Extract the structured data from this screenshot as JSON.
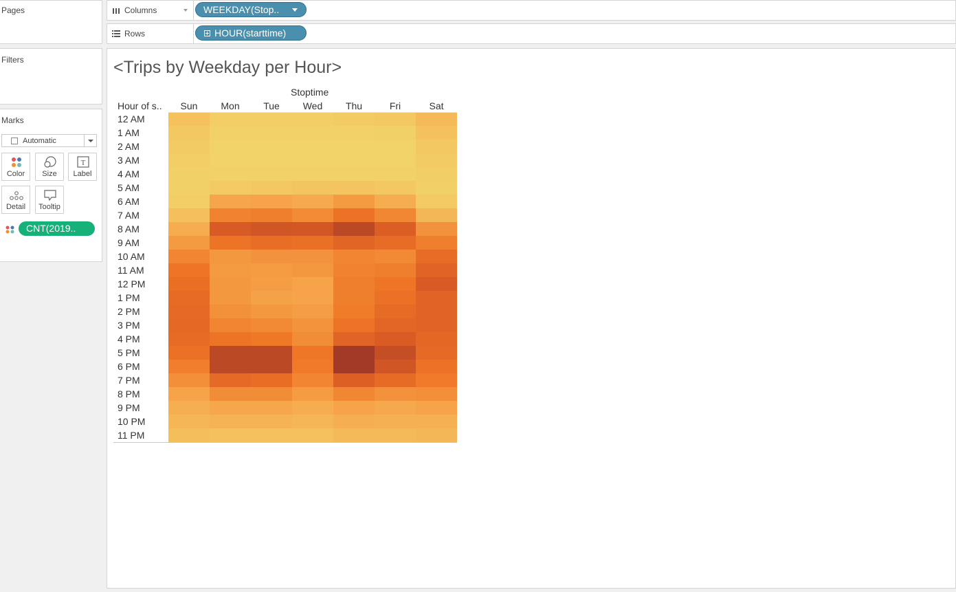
{
  "side": {
    "pages_title": "Pages",
    "filters_title": "Filters",
    "marks_title": "Marks",
    "mark_type": "Automatic",
    "buttons": [
      "Color",
      "Size",
      "Label",
      "Detail",
      "Tooltip"
    ],
    "measure_pill": "CNT(2019.."
  },
  "shelves": {
    "columns_label": "Columns",
    "rows_label": "Rows",
    "columns_pill": "WEEKDAY(Stop..",
    "rows_pill": "HOUR(starttime)"
  },
  "view": {
    "title": "<Trips by Weekday per Hour>",
    "column_dimension": "Stoptime",
    "row_header": "Hour of s.."
  },
  "colors": {
    "pill_blue": "#4a8fad",
    "pill_green": "#16b079",
    "heat_low": "#f2d36a",
    "heat_high": "#a33a28"
  },
  "chart_data": {
    "type": "heatmap",
    "title": "<Trips by Weekday per Hour>",
    "columns": [
      "Sun",
      "Mon",
      "Tue",
      "Wed",
      "Thu",
      "Fri",
      "Sat"
    ],
    "rows": [
      "12 AM",
      "1 AM",
      "2 AM",
      "3 AM",
      "4 AM",
      "5 AM",
      "6 AM",
      "7 AM",
      "8 AM",
      "9 AM",
      "10 AM",
      "11 AM",
      "12 PM",
      "1 PM",
      "2 PM",
      "3 PM",
      "4 PM",
      "5 PM",
      "6 PM",
      "7 PM",
      "8 PM",
      "9 PM",
      "10 PM",
      "11 PM"
    ],
    "values": [
      [
        0.12,
        0.04,
        0.04,
        0.04,
        0.05,
        0.07,
        0.16
      ],
      [
        0.08,
        0.01,
        0.01,
        0.01,
        0.01,
        0.02,
        0.12
      ],
      [
        0.05,
        0.0,
        0.0,
        0.0,
        0.0,
        0.0,
        0.07
      ],
      [
        0.04,
        0.0,
        0.0,
        0.0,
        0.0,
        0.0,
        0.05
      ],
      [
        0.02,
        0.01,
        0.01,
        0.01,
        0.01,
        0.01,
        0.03
      ],
      [
        0.02,
        0.06,
        0.07,
        0.09,
        0.1,
        0.07,
        0.02
      ],
      [
        0.04,
        0.3,
        0.31,
        0.27,
        0.36,
        0.25,
        0.06
      ],
      [
        0.13,
        0.48,
        0.5,
        0.44,
        0.58,
        0.46,
        0.18
      ],
      [
        0.25,
        0.78,
        0.81,
        0.8,
        0.9,
        0.75,
        0.4
      ],
      [
        0.36,
        0.57,
        0.62,
        0.6,
        0.69,
        0.63,
        0.5
      ],
      [
        0.47,
        0.37,
        0.4,
        0.4,
        0.47,
        0.45,
        0.63
      ],
      [
        0.56,
        0.36,
        0.35,
        0.37,
        0.48,
        0.5,
        0.7
      ],
      [
        0.61,
        0.37,
        0.34,
        0.31,
        0.5,
        0.56,
        0.78
      ],
      [
        0.64,
        0.37,
        0.32,
        0.31,
        0.5,
        0.59,
        0.7
      ],
      [
        0.65,
        0.41,
        0.37,
        0.34,
        0.52,
        0.64,
        0.7
      ],
      [
        0.66,
        0.47,
        0.45,
        0.39,
        0.57,
        0.68,
        0.7
      ],
      [
        0.64,
        0.57,
        0.54,
        0.43,
        0.7,
        0.76,
        0.67
      ],
      [
        0.59,
        0.9,
        0.9,
        0.55,
        1.0,
        0.86,
        0.65
      ],
      [
        0.51,
        0.9,
        0.9,
        0.53,
        1.0,
        0.81,
        0.58
      ],
      [
        0.42,
        0.65,
        0.62,
        0.47,
        0.74,
        0.64,
        0.53
      ],
      [
        0.31,
        0.43,
        0.43,
        0.35,
        0.46,
        0.4,
        0.42
      ],
      [
        0.24,
        0.29,
        0.29,
        0.25,
        0.31,
        0.28,
        0.31
      ],
      [
        0.19,
        0.21,
        0.21,
        0.19,
        0.24,
        0.23,
        0.23
      ],
      [
        0.14,
        0.12,
        0.12,
        0.12,
        0.16,
        0.17,
        0.18
      ]
    ],
    "color_scale": "sequential orange (light = fewer trips, dark = more trips)"
  }
}
